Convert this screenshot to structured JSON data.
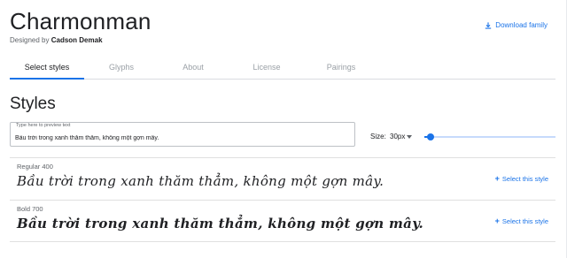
{
  "header": {
    "family_name": "Charmonman",
    "designed_by_prefix": "Designed by",
    "designer": "Cadson Demak",
    "download_label": "Download family",
    "download_icon": "download-icon"
  },
  "tabs": [
    {
      "label": "Select styles",
      "active": true
    },
    {
      "label": "Glyphs",
      "active": false
    },
    {
      "label": "About",
      "active": false
    },
    {
      "label": "License",
      "active": false
    },
    {
      "label": "Pairings",
      "active": false
    }
  ],
  "styles_section": {
    "title": "Styles",
    "preview": {
      "label": "Type here to preview text",
      "value": "Bầu trời trong xanh thăm thẳm, không một gợn mây."
    },
    "size": {
      "label": "Size:",
      "value": "30px",
      "slider_fraction": 0.05
    },
    "rows": [
      {
        "name": "Regular 400",
        "sample": "Bầu trời trong xanh thăm thẳm, không một gợn mây.",
        "action": "Select this style"
      },
      {
        "name": "Bold 700",
        "sample": "Bầu trời trong xanh thăm thẳm, không một gợn mây.",
        "action": "Select this style"
      }
    ]
  },
  "colors": {
    "accent": "#1a73e8",
    "text": "#202124",
    "muted": "#5f6368"
  }
}
